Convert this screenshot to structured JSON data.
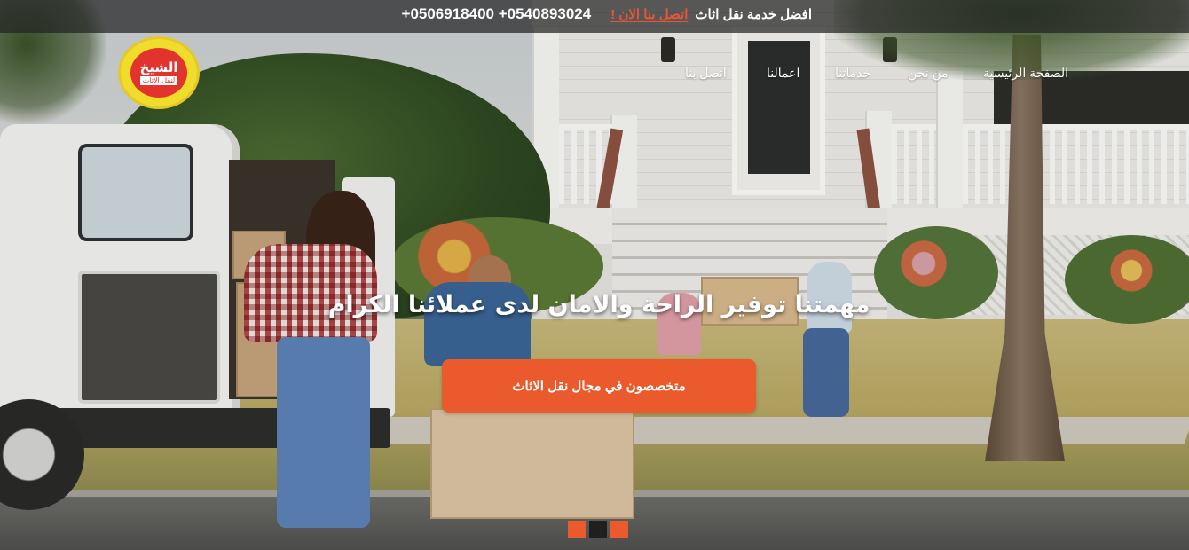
{
  "topbar": {
    "tagline": "افضل خدمة نقل اثاث",
    "cta": "اتصل بنا الان !",
    "phones": "+0506918400 +0540893024"
  },
  "logo": {
    "main": "الشيخ",
    "sub": "لنقل الاثاث"
  },
  "nav": {
    "items": [
      {
        "label": "الصفحة الرئيسية"
      },
      {
        "label": "من نحن"
      },
      {
        "label": "خدماتنا"
      },
      {
        "label": "اعمالنا"
      },
      {
        "label": "اتصل بنا"
      }
    ]
  },
  "hero": {
    "headline": "مهمتنا توفير الراحة والامان لدى عملائنا الكرام",
    "cta_label": "متخصصون في مجال نقل الاثاث"
  },
  "slider": {
    "count": 3,
    "active_index": 1
  },
  "colors": {
    "accent": "#ea5a2c",
    "topbar_bg": "#232323",
    "logo_yellow": "#f0dc2a",
    "logo_red": "#e2332c"
  }
}
